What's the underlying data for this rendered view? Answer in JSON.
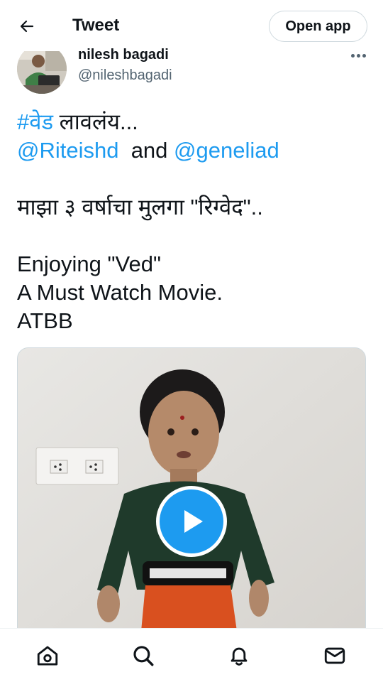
{
  "header": {
    "back_icon": "arrow-left-icon",
    "title": "Tweet",
    "open_app_label": "Open app"
  },
  "tweet": {
    "author": {
      "display_name": "nilesh bagadi",
      "handle": "@nileshbagadi"
    },
    "more_icon": "more-horizontal-icon",
    "text": {
      "hashtag": "#वेड",
      "line1_rest": " लावलंय...",
      "mention1": "@Riteishd",
      "and_word": "  and ",
      "mention2": "@geneliad",
      "line3": "माझा ३ वर्षाचा मुलगा \"रिग्वेद\"..",
      "line4": "Enjoying \"Ved\"",
      "line5": "A Must Watch Movie.",
      "line6": "ATBB"
    },
    "media": {
      "type": "video",
      "play_icon": "play-icon"
    }
  },
  "bottom_nav": [
    {
      "icon": "home-icon"
    },
    {
      "icon": "search-icon"
    },
    {
      "icon": "bell-icon"
    },
    {
      "icon": "mail-icon"
    }
  ],
  "colors": {
    "link": "#1d9bf0",
    "text": "#0f1419",
    "secondary": "#536471",
    "border": "#cfd9de"
  }
}
